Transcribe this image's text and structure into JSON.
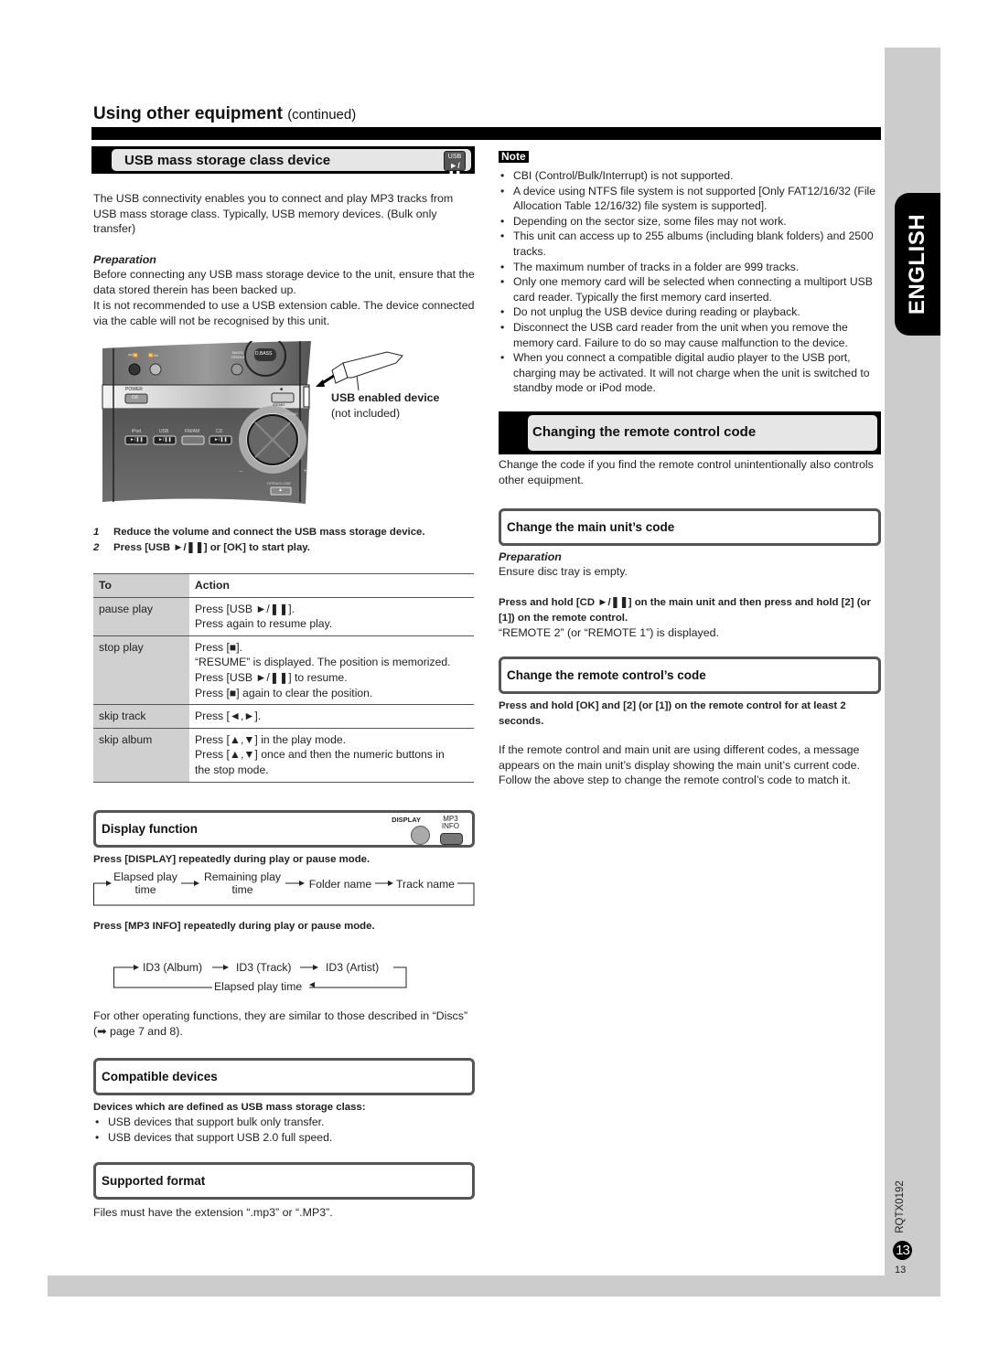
{
  "side": {
    "language_tab": "ENGLISH",
    "doc_code": "RQTX0192",
    "page_number_circle": "13",
    "page_number": "13"
  },
  "page_title": {
    "main": "Using other equipment",
    "suffix": "(continued)"
  },
  "usb_section": {
    "heading": "USB mass storage class device",
    "badge_top": "USB",
    "badge_bottom": "►/❚❚",
    "intro": "The USB connectivity enables you to connect and play MP3 tracks from USB mass storage class. Typically, USB memory devices. (Bulk only transfer)",
    "prep_label": "Preparation",
    "prep_text_1": "Before connecting any USB mass storage device to the unit, ensure that the data stored therein has been backed up.",
    "prep_text_2": "It is not recommended to use a USB extension cable. The device connected via the cable will not be recognised by this unit.",
    "figure": {
      "caption_bold": "USB enabled device",
      "caption_note": "(not included)",
      "labels": {
        "skip_back": "⏮/⏪",
        "skip_fwd": "⏩/⏭",
        "bass_treble": "BASS/ TREBLE",
        "dbass": "D.BASS",
        "power": "POWER",
        "power_btn": "⏻/I",
        "stop": "■",
        "demo": "•DEMO",
        "volume": "VOLUME",
        "ipod": "iPod",
        "usb": "USB",
        "fmam": "FM/AM",
        "cd": "CD",
        "play_pause": "►/❚❚",
        "open_close": "OPEN/CLOSE",
        "eject": "▲",
        "minus": "–",
        "plus": "+"
      }
    },
    "steps": [
      {
        "num": "1",
        "text": "Reduce the volume and connect the USB mass storage device."
      },
      {
        "num": "2",
        "text": "Press [USB ►/❚❚] or [OK] to start play."
      }
    ],
    "table": {
      "headers": [
        "To",
        "Action"
      ],
      "rows": [
        {
          "to": "pause play",
          "action": [
            "Press [USB ►/❚❚].",
            "Press again to resume play."
          ]
        },
        {
          "to": "stop play",
          "action": [
            "Press [■].",
            "“RESUME” is displayed. The position is memorized.",
            "Press [USB ►/❚❚] to resume.",
            "Press [■] again to clear the position."
          ]
        },
        {
          "to": "skip track",
          "action": [
            "Press [◄,►]."
          ]
        },
        {
          "to": "skip album",
          "action": [
            "Press [▲,▼] in the play mode.",
            "Press [▲,▼] once and then the numeric buttons in",
            "the stop mode."
          ]
        }
      ]
    }
  },
  "display_function": {
    "heading": "Display function",
    "display_btn_label": "DISPLAY",
    "mp3_btn_label_1": "MP3",
    "mp3_btn_label_2": "INFO",
    "instruction_1": "Press [DISPLAY] repeatedly during play or pause mode.",
    "flow_1": [
      "Elapsed play time",
      "Remaining play time",
      "Folder name",
      "Track name"
    ],
    "flow_1_parts": {
      "a1": "Elapsed play",
      "a2": "time",
      "b1": "Remaining play",
      "b2": "time",
      "c": "Folder name",
      "d": "Track name"
    },
    "instruction_2": "Press [MP3 INFO] repeatedly during play or pause mode.",
    "flow_2": [
      "ID3 (Album)",
      "ID3 (Track)",
      "ID3 (Artist)",
      "Elapsed play time"
    ],
    "other_functions": "For other operating functions, they are similar to those described in “Discs” (➡ page 7 and 8)."
  },
  "compatible_devices": {
    "heading": "Compatible devices",
    "intro": "Devices which are defined as USB mass storage class:",
    "items": [
      "USB devices that support bulk only transfer.",
      "USB devices that support USB 2.0 full speed."
    ]
  },
  "supported_format": {
    "heading": "Supported format",
    "text": "Files must have the extension “.mp3” or “.MP3”."
  },
  "note": {
    "label": "Note",
    "items": [
      "CBI (Control/Bulk/Interrupt) is not supported.",
      "A device using NTFS file system is not supported [Only FAT12/16/32 (File Allocation Table 12/16/32) file system is supported].",
      "Depending on the sector size, some files may not work.",
      "This unit can access up to 255 albums (including blank folders) and 2500 tracks.",
      "The maximum number of tracks in a folder are 999 tracks.",
      "Only one memory card will be selected when connecting a multiport USB card reader. Typically the first memory card inserted.",
      "Do not unplug the USB device during reading or playback.",
      "Disconnect the USB card reader from the unit when you remove the memory card. Failure to do so may cause malfunction to the device.",
      "When you connect a compatible digital audio player to the USB port, charging may be activated. It will not charge when the unit is switched to standby mode or iPod mode."
    ]
  },
  "remote_code": {
    "heading": "Changing the remote control code",
    "intro": "Change the code if you find the remote control unintentionally also controls other equipment.",
    "main_unit": {
      "heading": "Change the main unit’s code",
      "prep_label": "Preparation",
      "prep_text": "Ensure disc tray is empty.",
      "instruction": "Press and hold [CD ►/❚❚] on the main unit and then press and hold [2] (or [1]) on the remote control.",
      "result": "“REMOTE 2” (or “REMOTE 1”) is displayed."
    },
    "remote": {
      "heading": "Change the remote control’s code",
      "instruction": "Press and hold [OK] and [2] (or [1]) on the remote control for at least 2 seconds.",
      "explanation": "If the remote control and main unit are using different codes, a message appears on the main unit’s display showing the main unit’s current code. Follow the above step to change the remote control’s code to match it."
    }
  }
}
